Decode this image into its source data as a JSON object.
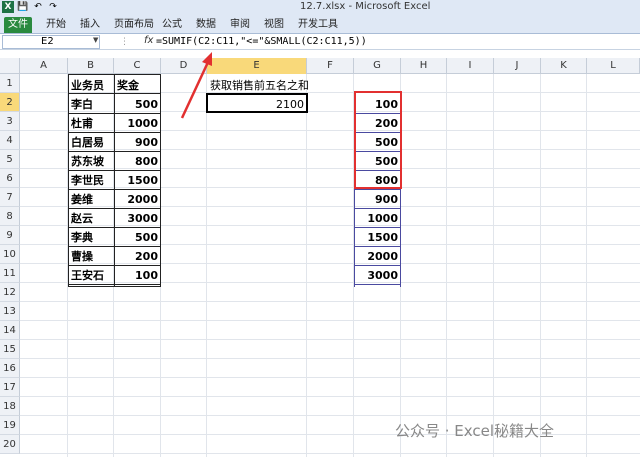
{
  "window": {
    "title": "12.7.xlsx - Microsoft Excel",
    "app_icon": "X"
  },
  "ribbon": {
    "tabs": [
      "文件",
      "开始",
      "插入",
      "页面布局",
      "公式",
      "数据",
      "审阅",
      "视图",
      "开发工具"
    ]
  },
  "formula_bar": {
    "name_box": "E2",
    "fx": "fx",
    "formula": "=SUMIF(C2:C11,\"<=\"&SMALL(C2:C11,5))"
  },
  "columns": [
    "A",
    "B",
    "C",
    "D",
    "E",
    "F",
    "G",
    "H",
    "I",
    "J",
    "K",
    "L"
  ],
  "rows": [
    "1",
    "2",
    "3",
    "4",
    "5",
    "6",
    "7",
    "8",
    "9",
    "10",
    "11",
    "12",
    "13",
    "14",
    "15",
    "16",
    "17",
    "18",
    "19",
    "20"
  ],
  "selected_cell": "E2",
  "table": {
    "header_name": "业务员",
    "header_bonus": "奖金",
    "names": [
      "李白",
      "杜甫",
      "白居易",
      "苏东坡",
      "李世民",
      "姜维",
      "赵云",
      "李典",
      "曹操",
      "王安石"
    ],
    "bonus": [
      "500",
      "1000",
      "900",
      "800",
      "1500",
      "2000",
      "3000",
      "500",
      "200",
      "100"
    ]
  },
  "result": {
    "label": "获取销售前五名之和",
    "value": "2100"
  },
  "sorted_g": [
    "100",
    "200",
    "500",
    "500",
    "800",
    "900",
    "1000",
    "1500",
    "2000",
    "3000"
  ],
  "watermark": "公众号 · Excel秘籍大全",
  "colors": {
    "highlight_red": "#e23030",
    "selected_header": "#f9d97a",
    "file_tab_green": "#2a8a3f"
  }
}
